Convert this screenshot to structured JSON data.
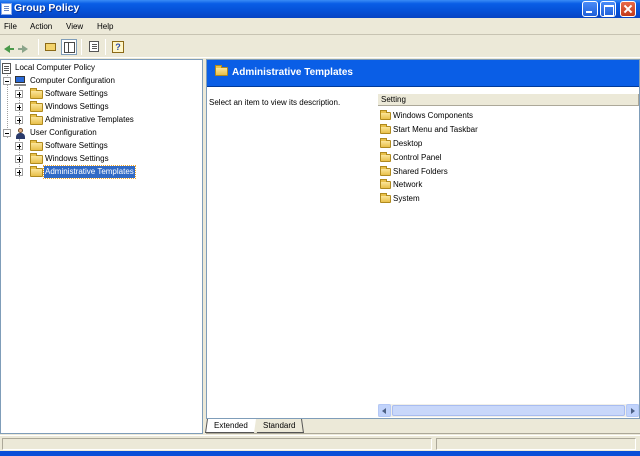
{
  "window": {
    "title": "Group Policy"
  },
  "menu": [
    "File",
    "Action",
    "View",
    "Help"
  ],
  "toolbar": [
    "back-icon",
    "forward-icon",
    "up-folder-icon",
    "show-hide-tree-icon",
    "export-list-icon",
    "help-icon"
  ],
  "tree": [
    {
      "label": "Local Computer Policy",
      "icon": "policy-icon"
    },
    {
      "label": "Computer Configuration",
      "icon": "computer-icon",
      "expanded": true
    },
    {
      "label": "Software Settings",
      "icon": "folder-icon"
    },
    {
      "label": "Windows Settings",
      "icon": "folder-icon"
    },
    {
      "label": "Administrative Templates",
      "icon": "folder-icon"
    },
    {
      "label": "User Configuration",
      "icon": "user-icon",
      "expanded": true
    },
    {
      "label": "Software Settings",
      "icon": "folder-icon"
    },
    {
      "label": "Windows Settings",
      "icon": "folder-icon"
    },
    {
      "label": "Administrative Templates",
      "icon": "folder-icon",
      "selected": true
    }
  ],
  "details": {
    "header_title": "Administrative Templates",
    "description": "Select an item to view its description.",
    "column_header": "Setting",
    "items": [
      "Windows Components",
      "Start Menu and Taskbar",
      "Desktop",
      "Control Panel",
      "Shared Folders",
      "Network",
      "System"
    ]
  },
  "tabs": {
    "extended": "Extended",
    "standard": "Standard",
    "active": "Extended"
  },
  "colors": {
    "titlebar": "#0a5ee6",
    "header_band": "#0a5ee6",
    "selection": "#316ac5",
    "folder": "#e8c04a"
  }
}
